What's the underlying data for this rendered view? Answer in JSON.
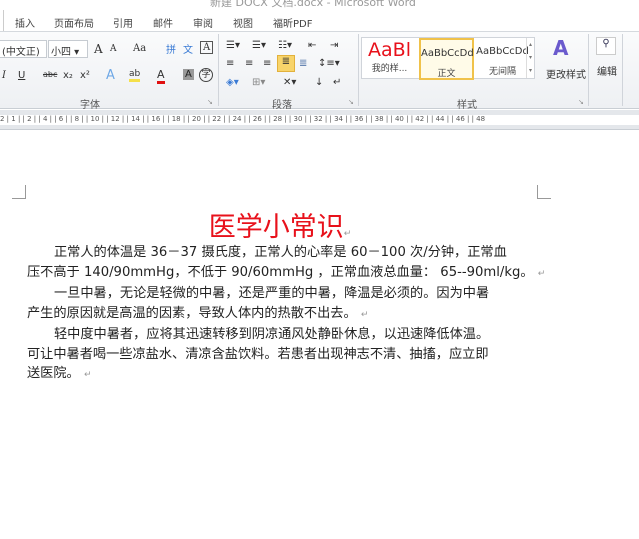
{
  "window": {
    "title": "新建 DOCX 文档.docx - Microsoft Word"
  },
  "tabs": [
    "插入",
    "页面布局",
    "引用",
    "邮件",
    "审阅",
    "视图",
    "福昕PDF"
  ],
  "font_group": {
    "font_name": "(中文正)",
    "font_size": "小四",
    "grow": "A",
    "shrink": "A",
    "change_case": "Aa",
    "phonetic": "文",
    "char_border": "A",
    "italic": "I",
    "underline": "U",
    "strike": "abc",
    "subscript": "x₂",
    "superscript": "x²",
    "text_effect": "A",
    "highlight": "ab",
    "font_color": "A",
    "char_shading": "A",
    "enclose": "字",
    "label": "字体"
  },
  "paragraph_group": {
    "label": "段落"
  },
  "styles_group": {
    "items": [
      {
        "preview": "AaBl",
        "name": "我的样..."
      },
      {
        "preview": "AaBbCcDd",
        "name": "正文"
      },
      {
        "preview": "AaBbCcDd",
        "name": "无间隔"
      }
    ],
    "change_styles": "更改样式",
    "label": "样式"
  },
  "editing_group": {
    "label": "编辑"
  },
  "ruler": {
    "ticks": "2 | 1 | | 2 | | 4 | | 6 | | 8 | | 10 | | 12 | | 14 | | 16 | | 18 | | 20 | | 22 | | 24 | | 26 | | 28 | | 30 | | 32 | | 34 | | 36 | | 38 | | 40 | | 42 | | 44 | | 46 | | 48"
  },
  "document": {
    "title": "医学小常识",
    "lines": [
      "正常人的体温是 36－37 摄氏度，正常人的心率是 60－100 次/分钟，正常血",
      "压不高于 140/90mmHg，不低于 90/60mmHg ，正常血液总血量： 65--90ml/kg。",
      "一旦中暑，无论是轻微的中暑，还是严重的中暑，降温是必须的。因为中暑",
      "产生的原因就是高温的因素，导致人体内的热散不出去。",
      "轻中度中暑者，应将其迅速转移到阴凉通风处静卧休息，以迅速降低体温。",
      "可让中暑者喝一些凉盐水、清凉含盐饮料。若患者出现神志不清、抽搐，应立即",
      "送医院。"
    ]
  },
  "colors": {
    "title": "#e8111b",
    "highlight_yellow": "#f5e04a",
    "font_red": "#e01010"
  }
}
